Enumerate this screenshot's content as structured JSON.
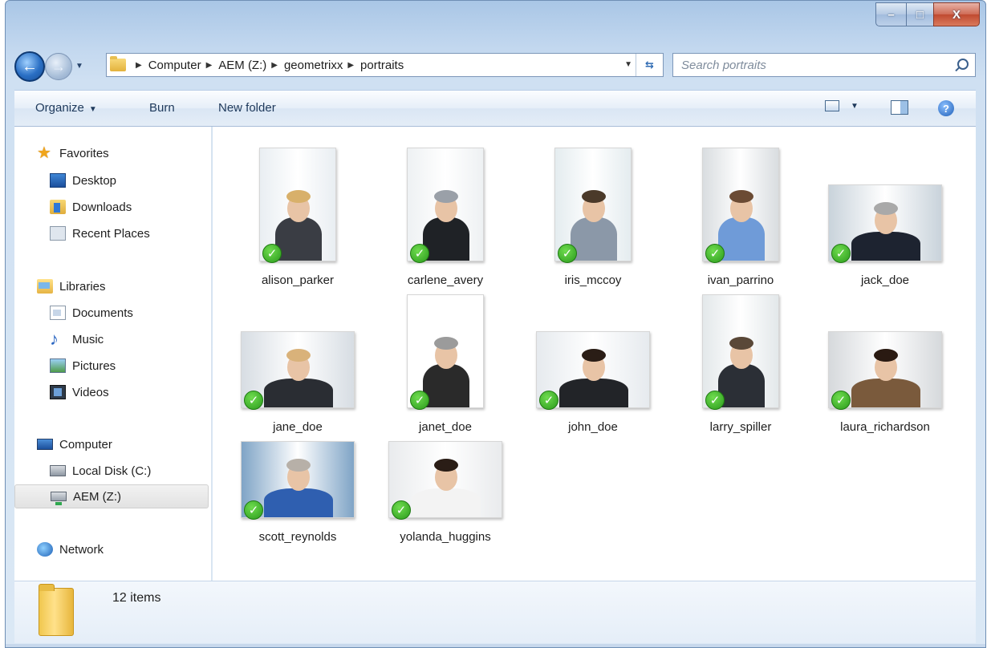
{
  "window": {
    "caption": {
      "minimize_glyph": "–",
      "maximize_glyph": "□",
      "close_glyph": "X"
    }
  },
  "nav": {
    "back_glyph": "←",
    "forward_glyph": "→",
    "breadcrumbs": [
      "Computer",
      "AEM (Z:)",
      "geometrixx",
      "portraits"
    ],
    "search_placeholder": "Search portraits"
  },
  "toolbar": {
    "organize_label": "Organize",
    "burn_label": "Burn",
    "new_folder_label": "New folder",
    "help_glyph": "?"
  },
  "sidebar": {
    "favorites": {
      "label": "Favorites",
      "icon": "star-icon",
      "items": [
        {
          "label": "Desktop",
          "icon": "desktop-icon"
        },
        {
          "label": "Downloads",
          "icon": "downloads-icon"
        },
        {
          "label": "Recent Places",
          "icon": "recent-places-icon"
        }
      ]
    },
    "libraries": {
      "label": "Libraries",
      "icon": "libraries-icon",
      "items": [
        {
          "label": "Documents",
          "icon": "documents-icon"
        },
        {
          "label": "Music",
          "icon": "music-icon"
        },
        {
          "label": "Pictures",
          "icon": "pictures-icon"
        },
        {
          "label": "Videos",
          "icon": "videos-icon"
        }
      ]
    },
    "computer": {
      "label": "Computer",
      "icon": "computer-icon",
      "items": [
        {
          "label": "Local Disk (C:)",
          "icon": "local-disk-icon"
        },
        {
          "label": "AEM (Z:)",
          "icon": "network-drive-icon",
          "selected": true
        }
      ]
    },
    "network": {
      "label": "Network",
      "icon": "network-icon"
    }
  },
  "files": [
    {
      "name": "alison_parker",
      "sync_status": "synced",
      "orientation": "portrait"
    },
    {
      "name": "carlene_avery",
      "sync_status": "synced",
      "orientation": "portrait"
    },
    {
      "name": "iris_mccoy",
      "sync_status": "synced",
      "orientation": "portrait"
    },
    {
      "name": "ivan_parrino",
      "sync_status": "synced",
      "orientation": "portrait"
    },
    {
      "name": "jack_doe",
      "sync_status": "synced",
      "orientation": "landscape"
    },
    {
      "name": "jane_doe",
      "sync_status": "synced",
      "orientation": "landscape"
    },
    {
      "name": "janet_doe",
      "sync_status": "synced",
      "orientation": "portrait"
    },
    {
      "name": "john_doe",
      "sync_status": "synced",
      "orientation": "landscape"
    },
    {
      "name": "larry_spiller",
      "sync_status": "synced",
      "orientation": "portrait"
    },
    {
      "name": "laura_richardson",
      "sync_status": "synced",
      "orientation": "landscape"
    },
    {
      "name": "scott_reynolds",
      "sync_status": "synced",
      "orientation": "landscape"
    },
    {
      "name": "yolanda_huggins",
      "sync_status": "synced",
      "orientation": "landscape"
    }
  ],
  "status": {
    "item_count": "12 items"
  },
  "colors": {
    "frame": "#c3d8ef",
    "accent": "#1e395b",
    "check": "#2a9a1b",
    "folder": "#f0c74e"
  }
}
